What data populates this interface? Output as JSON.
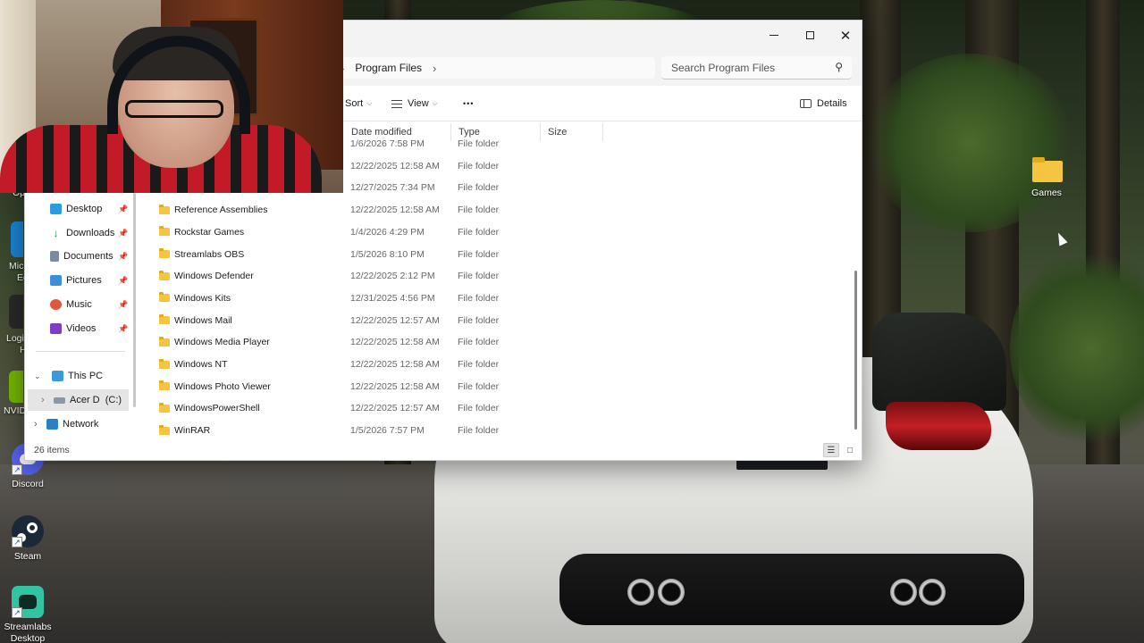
{
  "explorer": {
    "breadcrumb": {
      "current": "Program Files"
    },
    "search": {
      "placeholder": "Search Program Files"
    },
    "toolbar": {
      "sort": "Sort",
      "view": "View",
      "more": "•••",
      "details": "Details"
    },
    "columns": {
      "date": "Date modified",
      "type": "Type",
      "size": "Size"
    },
    "nav": {
      "quick_access": [
        {
          "label": "Desktop",
          "icon": "desktop-icon",
          "color": "#2a9de0"
        },
        {
          "label": "Downloads",
          "icon": "download-icon",
          "color": "#1f8f4c"
        },
        {
          "label": "Documents",
          "icon": "document-icon",
          "color": "#7a8aa0"
        },
        {
          "label": "Pictures",
          "icon": "pictures-icon",
          "color": "#3c8fd8"
        },
        {
          "label": "Music",
          "icon": "music-icon",
          "color": "#e0583a"
        },
        {
          "label": "Videos",
          "icon": "videos-icon",
          "color": "#7b3fc4"
        }
      ],
      "this_pc": "This PC",
      "drive": "Acer D  (C:)",
      "network": "Network"
    },
    "rows": [
      {
        "name": "",
        "date": "1/6/2026 7:58 PM",
        "type": "File folder"
      },
      {
        "name": "",
        "date": "12/22/2025 12:58 AM",
        "type": "File folder"
      },
      {
        "name": "",
        "date": "12/27/2025 7:34 PM",
        "type": "File folder"
      },
      {
        "name": "Reference Assemblies",
        "date": "12/22/2025 12:58 AM",
        "type": "File folder"
      },
      {
        "name": "Rockstar Games",
        "date": "1/4/2026 4:29 PM",
        "type": "File folder"
      },
      {
        "name": "Streamlabs OBS",
        "date": "1/5/2026 8:10 PM",
        "type": "File folder"
      },
      {
        "name": "Windows Defender",
        "date": "12/22/2025 2:12 PM",
        "type": "File folder"
      },
      {
        "name": "Windows Kits",
        "date": "12/31/2025 4:56 PM",
        "type": "File folder"
      },
      {
        "name": "Windows Mail",
        "date": "12/22/2025 12:57 AM",
        "type": "File folder"
      },
      {
        "name": "Windows Media Player",
        "date": "12/22/2025 12:58 AM",
        "type": "File folder"
      },
      {
        "name": "Windows NT",
        "date": "12/22/2025 12:58 AM",
        "type": "File folder"
      },
      {
        "name": "Windows Photo Viewer",
        "date": "12/22/2025 12:58 AM",
        "type": "File folder"
      },
      {
        "name": "WindowsPowerShell",
        "date": "12/22/2025 12:57 AM",
        "type": "File folder"
      },
      {
        "name": "WinRAR",
        "date": "1/5/2026 7:57 PM",
        "type": "File folder"
      }
    ],
    "status": {
      "count": "26 items"
    }
  },
  "desktop": {
    "games": "Games",
    "discord": "Discord",
    "steam": "Steam",
    "streamlabs": "Streamlabs Desktop",
    "partial_left": [
      "Op",
      "Mic",
      "Ec",
      "Logi",
      "H",
      "NVID"
    ]
  },
  "colors": {
    "folder": "#f5c542",
    "discord": "#5865f2",
    "steam": "#1b2838",
    "streamlabs": "#31c3a2"
  }
}
